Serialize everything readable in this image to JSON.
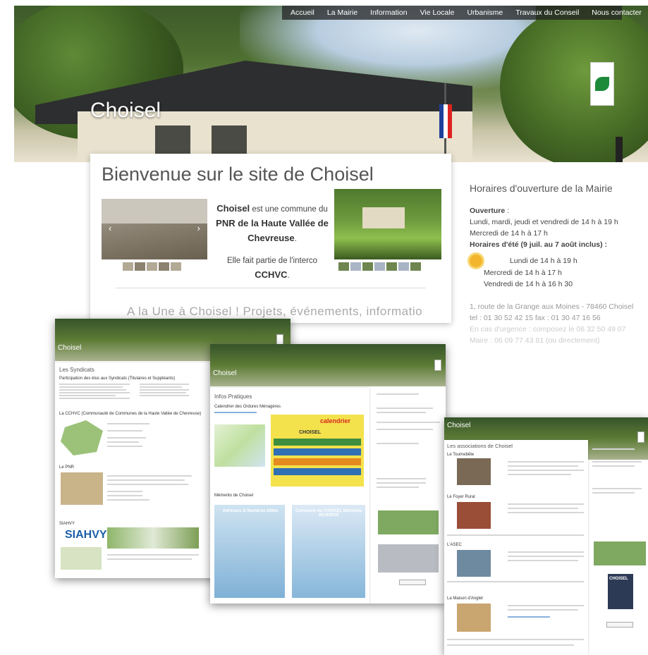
{
  "nav": {
    "items": [
      "Accueil",
      "La Mairie",
      "Information",
      "Vie Locale",
      "Urbanisme",
      "Travaux du Conseil",
      "Nous contacter"
    ]
  },
  "hero": {
    "title": "Choisel"
  },
  "main": {
    "welcome": "Bienvenue sur le site de Choisel",
    "intro_name": "Choisel",
    "intro_text1": " est une commune du ",
    "intro_pnr": "PNR de la Haute Vallée de Chevreuse",
    "intro_end": ".",
    "intro_text2": "Elle fait partie de l'interco ",
    "intro_cchvc": "CCHVC",
    "intro_dot": ".",
    "une": "A la Une à Choisel ! Projets, événements, informatio",
    "slider_prev": "‹",
    "slider_next": "›"
  },
  "info": {
    "title": "Horaires d'ouverture de la Mairie",
    "ouverture_label": "Ouverture",
    "ouverture_colon": " :",
    "line1": "Lundi, mardi, jeudi et vendredi de 14 h à 19 h",
    "line2": "Mercredi de 14 h à 17 h",
    "ete_label": "Horaires d'été (9 juil. au 7 août inclus) :",
    "ete1": "Lundi de 14 h à 19 h",
    "ete2": "Mercredi de 14 h à 17 h",
    "ete3": "Vendredi de 14 h à 16 h 30",
    "addr": "1, route de la Grange aux Moines - 78460 Choisel",
    "tel": "tel : 01 30 52 42 15 fax : 01 30 47 16 56",
    "urgence": "En cas d'urgence : composez le 06 32 50 49 07",
    "faded": "Maire : 06 09 77 43 81 (ou directement)"
  },
  "cards": {
    "c1_site": "Choisel",
    "c1_heading": "Les Syndicats",
    "c1_sub": "Participation des élus aux Syndicats (Titulaires et Suppléants)",
    "c1_section": "La CCHVC (Communauté de Communes de la Haute Vallée de Chevreuse)",
    "c1_pnr": "Le PNR",
    "c1_siahvy": "SIAHVY",
    "c2_site": "Choisel",
    "c2_heading": "Infos Pratiques",
    "c2_sub": "Calendrier des Ordures Ménagères",
    "c2_cal_title": "calendrier",
    "c2_cal_name": "CHOISEL",
    "c2_memo": "Mémento de Choisel",
    "c2_box1": "Adresses & Numéros Utiles",
    "c2_box2": "Commune de CHOISEL Memento 2014/2015",
    "c3_site": "Choisel",
    "c3_heading": "Les associations de Choisel",
    "c3_a1": "Le Tournebête",
    "c3_a2": "Le Foyer Rural",
    "c3_a3": "L'ASEC",
    "c3_a4": "La Maison d'Anglet",
    "c3_side": "CHOISEL"
  }
}
